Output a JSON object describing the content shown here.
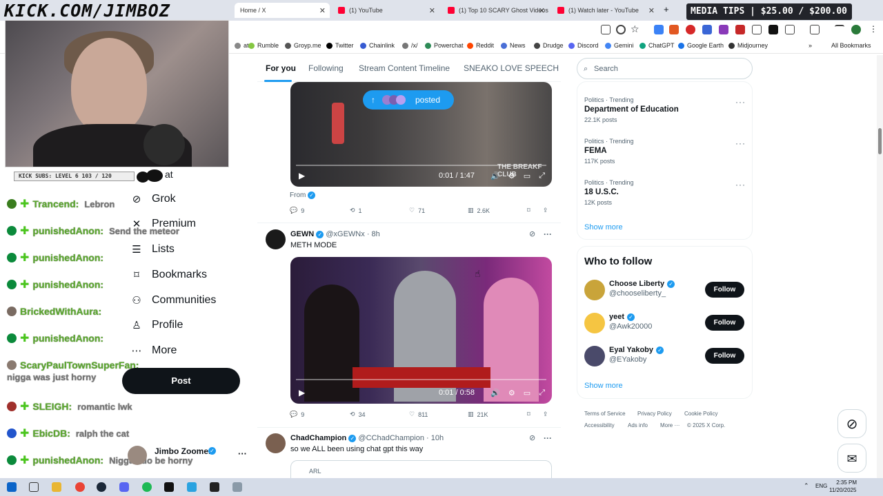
{
  "overlay": {
    "logo_text": "KICK.COM/JIMBOZ",
    "subs_bar": "KICK SUBS: LEVEL 6 103 / 120",
    "media_tips": "MEDIA TIPS | $25.00 / $200.00"
  },
  "browser": {
    "tabs": [
      {
        "label": "Home / X",
        "color": "#000000"
      },
      {
        "label": "(1) YouTube",
        "color": "#ff0033"
      },
      {
        "label": "(1) Top 10 SCARY Ghost Videos",
        "color": "#ff0033"
      },
      {
        "label": "(1) Watch later - YouTube",
        "color": "#ff0033"
      }
    ],
    "new_tab": "+",
    "bookmarks": [
      {
        "label": "at",
        "color": "#888888"
      },
      {
        "label": "Rumble",
        "color": "#85c742"
      },
      {
        "label": "Groyp.me",
        "color": "#555555"
      },
      {
        "label": "Twitter",
        "color": "#000000"
      },
      {
        "label": "Chainlink",
        "color": "#375bd2"
      },
      {
        "label": "/x/",
        "color": "#777777"
      },
      {
        "label": "Powerchat",
        "color": "#2e8b57"
      },
      {
        "label": "Reddit",
        "color": "#ff4500"
      },
      {
        "label": "News",
        "color": "#4a6fd6"
      },
      {
        "label": "Drudge",
        "color": "#444444"
      },
      {
        "label": "Discord",
        "color": "#5865f2"
      },
      {
        "label": "Gemini",
        "color": "#4285f4"
      },
      {
        "label": "ChatGPT",
        "color": "#10a37f"
      },
      {
        "label": "Google Earth",
        "color": "#1a73e8"
      },
      {
        "label": "Midjourney",
        "color": "#333333"
      }
    ],
    "all_bookmarks": "All Bookmarks"
  },
  "chat": [
    {
      "badge_color": "#3a7d1e",
      "name": "Trancend:",
      "msg": "Lebron"
    },
    {
      "badge_color": "#0b8a3b",
      "name": "punishedAnon:",
      "msg": "Send the meteor"
    },
    {
      "badge_color": "#0b8a3b",
      "name": "punishedAnon:",
      "msg": ""
    },
    {
      "badge_color": "#0b8a3b",
      "name": "punishedAnon:",
      "msg": ""
    },
    {
      "badge_color": "#7a6b62",
      "name": "BrickedWithAura:",
      "msg": ""
    },
    {
      "badge_color": "#0b8a3b",
      "name": "punishedAnon:",
      "msg": ""
    },
    {
      "badge_color": "#8a7a70",
      "name": "ScaryPaulTownSuperFan:",
      "msg": "nigga was just horny"
    },
    {
      "badge_color": "#a0302c",
      "name": "SLEIGH:",
      "msg": "romantic lwk"
    },
    {
      "badge_color": "#2255cc",
      "name": "EbicDB:",
      "msg": "ralph the cat"
    },
    {
      "badge_color": "#0b8a3b",
      "name": "punishedAnon:",
      "msg": "Niggas do be horny"
    }
  ],
  "nav": {
    "items": [
      {
        "icon": "grok-icon",
        "label": "Grok"
      },
      {
        "icon": "premium-icon",
        "label": "Premium"
      },
      {
        "icon": "lists-icon",
        "label": "Lists"
      },
      {
        "icon": "bookmark-icon",
        "label": "Bookmarks"
      },
      {
        "icon": "communities-icon",
        "label": "Communities"
      },
      {
        "icon": "profile-icon",
        "label": "Profile"
      },
      {
        "icon": "more-icon",
        "label": "More"
      }
    ],
    "post_label": "Post",
    "account_name": "Jimbo Zoomer",
    "account_more": "···"
  },
  "feed": {
    "tabs": [
      "For you",
      "Following",
      "Stream Content Timeline",
      "SNEAKO LOVE SPEECH"
    ],
    "posted_pill": "posted",
    "tweet1": {
      "video_time": "0:01 / 1:47",
      "from_label": "From",
      "watermark": "THE BREAKF CLUB",
      "replies": "9",
      "reposts": "1",
      "likes": "71",
      "views": "2.6K"
    },
    "tweet2": {
      "name": "GEWN",
      "handle": "@xGEWNx",
      "time": "· 8h",
      "text": "METH MODE",
      "video_time": "0:01 / 0:58",
      "replies": "9",
      "reposts": "34",
      "likes": "811",
      "views": "21K"
    },
    "tweet3": {
      "name": "ChadChampion",
      "handle": "@CChadChampion",
      "time": "· 10h",
      "text": "so we ALL been using chat gpt this way",
      "quote_preview": "ARL"
    }
  },
  "right": {
    "search_placeholder": "Search",
    "trends": [
      {
        "category": "Politics · Trending",
        "title": "Department of Education",
        "posts": "22.1K posts"
      },
      {
        "category": "Politics · Trending",
        "title": "FEMA",
        "posts": "117K posts"
      },
      {
        "category": "Politics · Trending",
        "title": "18 U.S.C.",
        "posts": "12K posts"
      }
    ],
    "show_more": "Show more",
    "who_to_follow": "Who to follow",
    "follow_suggestions": [
      {
        "name": "Choose Liberty",
        "handle": "@chooseliberty_",
        "color": "#c9a43a"
      },
      {
        "name": "yeet",
        "handle": "@Awk20000",
        "color": "#f5c542"
      },
      {
        "name": "Eyal Yakoby",
        "handle": "@EYakoby",
        "color": "#4a4a6a"
      }
    ],
    "follow_label": "Follow",
    "footer": [
      "Terms of Service",
      "Privacy Policy",
      "Cookie Policy",
      "Accessibility",
      "Ads info",
      "More ···",
      "© 2025 X Corp."
    ]
  },
  "taskbar": {
    "lang": "ENG",
    "time": "2:35 PM",
    "date": "11/20/2025"
  }
}
